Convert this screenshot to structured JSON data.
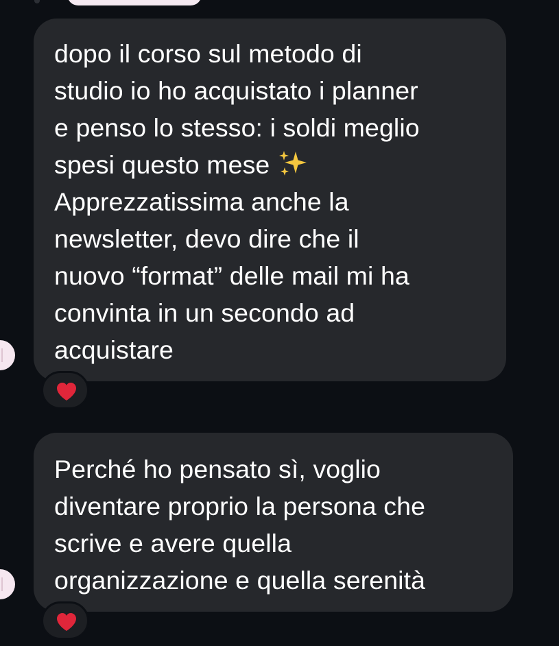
{
  "colors": {
    "background": "#0c0f14",
    "bubble": "#26282c",
    "text": "#ffffff",
    "reaction_heart": "#e0263a",
    "sparkles": "#f5c73f",
    "avatar": "#f6e7f0"
  },
  "messages": [
    {
      "lines": [
        "dopo il corso sul metodo di",
        "studio io ho acquistato i planner",
        "e penso lo stesso: i soldi meglio",
        "spesi questo mese",
        "Apprezzatissima anche la",
        "newsletter, devo dire che il",
        "nuovo “format” delle mail mi ha",
        "convinta in un secondo ad",
        "acquistare"
      ],
      "emoji": "sparkles-icon",
      "reaction": "heart-icon"
    },
    {
      "lines": [
        "Perché ho pensato sì, voglio",
        "diventare proprio la persona che",
        "scrive e avere quella",
        "organizzazione e quella serenità"
      ],
      "reaction": "heart-icon"
    }
  ]
}
